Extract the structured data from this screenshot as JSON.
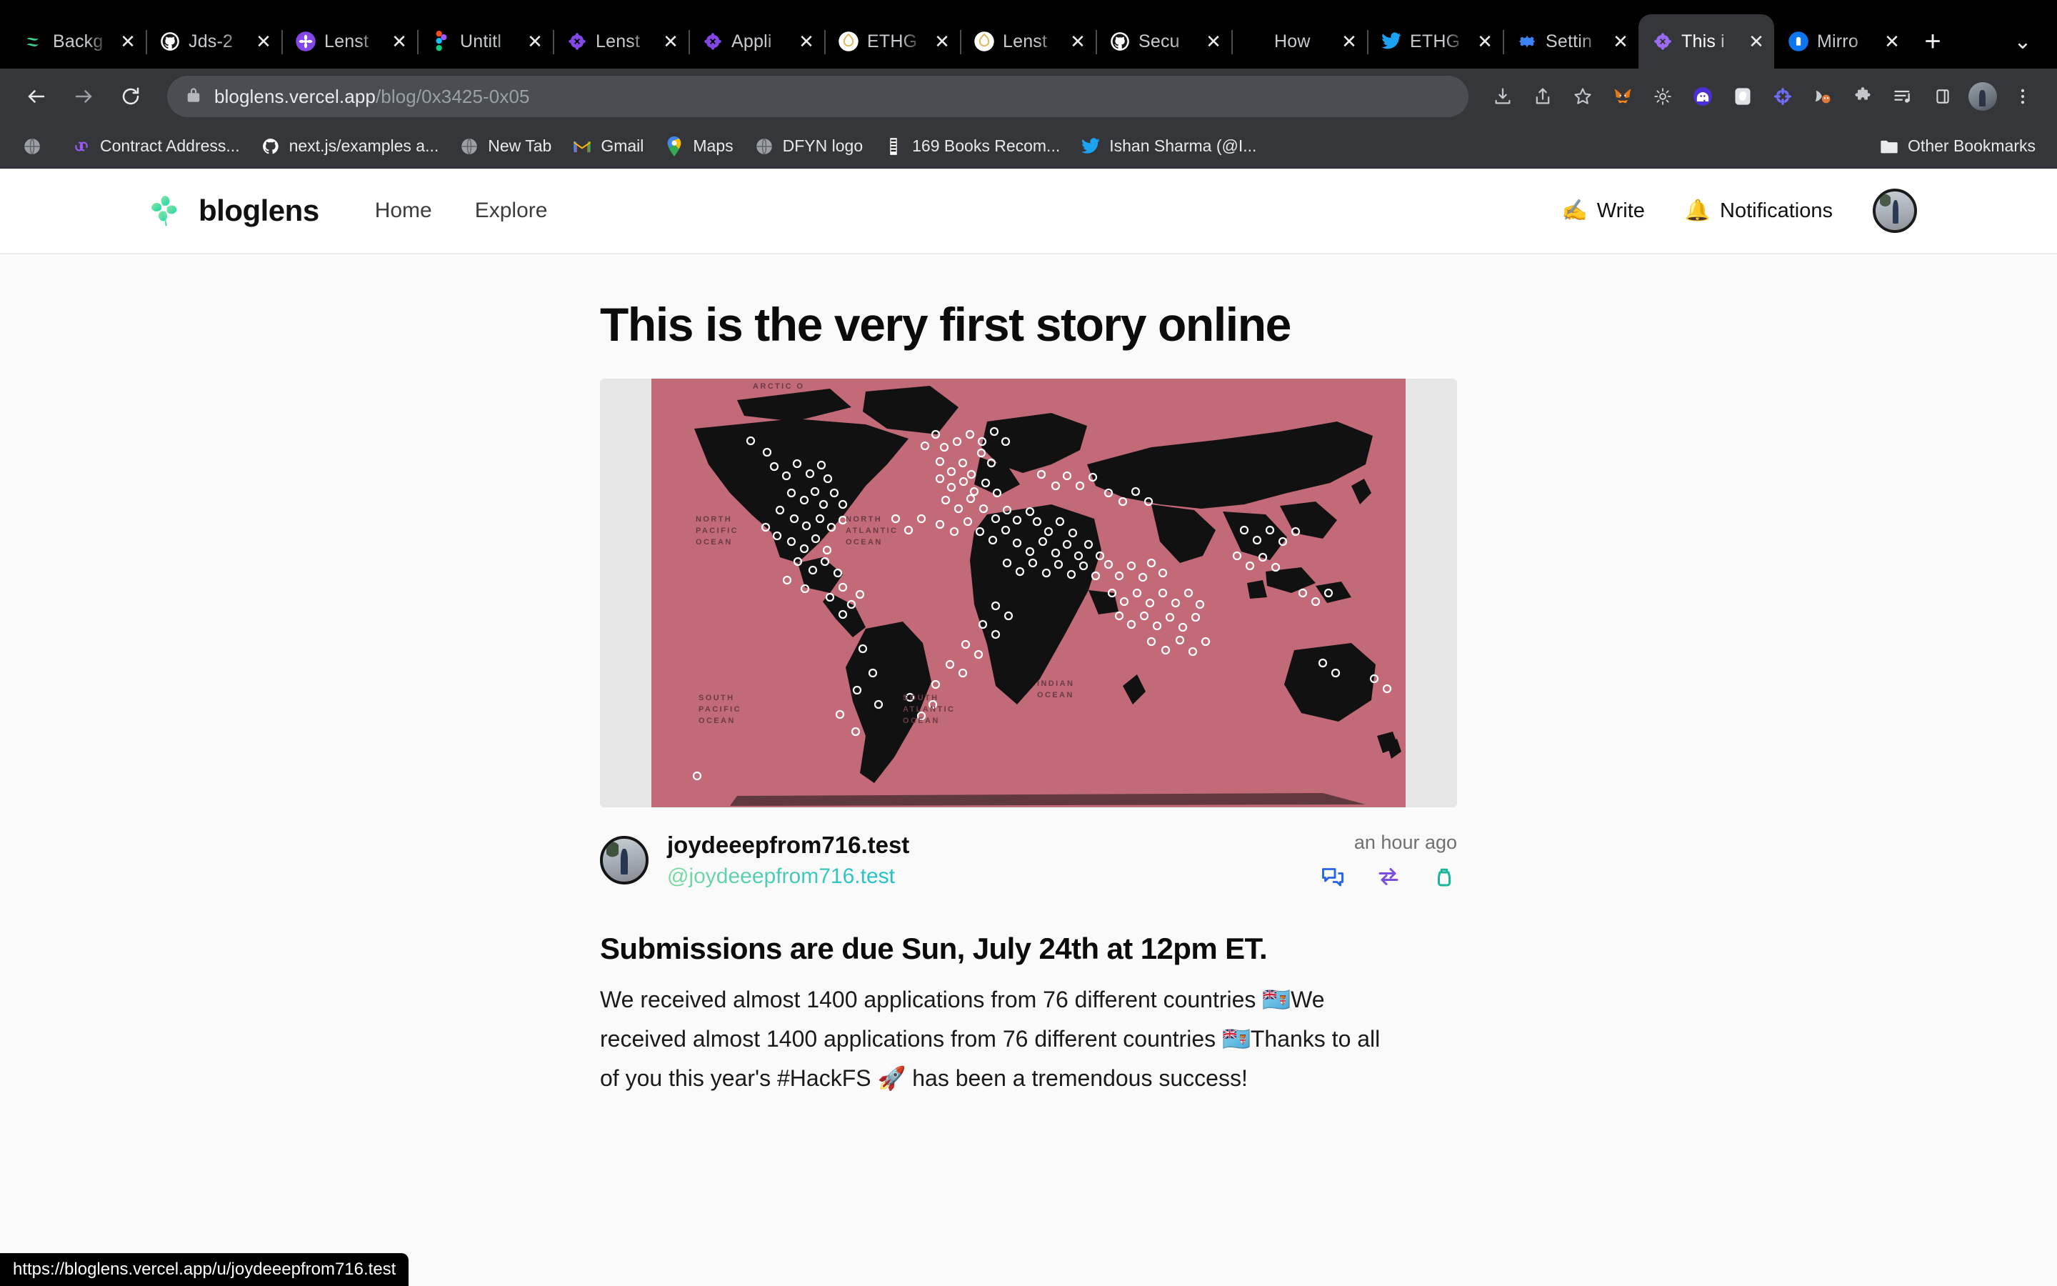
{
  "browser": {
    "tabs": [
      {
        "title": "Backg",
        "icon": "supabase-icon",
        "active": false
      },
      {
        "title": "Jds-2",
        "icon": "github-icon",
        "active": false
      },
      {
        "title": "Lenst",
        "icon": "lens-circle-icon",
        "active": false
      },
      {
        "title": "Untitl",
        "icon": "figma-icon",
        "active": false
      },
      {
        "title": "Lenst",
        "icon": "lens-flower-icon",
        "active": false
      },
      {
        "title": "Appli",
        "icon": "lens-flower-icon",
        "active": false
      },
      {
        "title": "ETHG",
        "icon": "ethglobal-icon",
        "active": false
      },
      {
        "title": "Lenst",
        "icon": "ethglobal-icon",
        "active": false
      },
      {
        "title": "Secu",
        "icon": "github-icon",
        "active": false
      },
      {
        "title": "How",
        "icon": "blank-icon",
        "active": false
      },
      {
        "title": "ETHG",
        "icon": "twitter-icon",
        "active": false
      },
      {
        "title": "Settin",
        "icon": "gear-icon",
        "active": false
      },
      {
        "title": "This i",
        "icon": "lens-flower-icon",
        "active": true
      },
      {
        "title": "Mirro",
        "icon": "mirror-icon",
        "active": false
      }
    ],
    "new_tab_label": "+",
    "tab_list_caret": "⌄",
    "nav": {
      "back": "←",
      "forward": "→",
      "reload": "⟳"
    },
    "omnibox": {
      "lock_icon": "lock-icon",
      "domain": "bloglens.vercel.app",
      "path": "/blog/0x3425-0x05"
    },
    "toolbar_right_icons": [
      "download-icon",
      "share-icon",
      "bookmark-star-icon",
      "metamask-icon",
      "brightness-icon",
      "phantom-icon",
      "rabby-icon",
      "flower-extension-icon",
      "fox-extension-icon",
      "puzzle-extension-icon",
      "reading-list-icon",
      "sidepanel-icon",
      "profile-avatar-icon",
      "kebab-menu-icon"
    ],
    "bookmarks": [
      {
        "label": "",
        "icon": "globe-icon"
      },
      {
        "label": "Contract Address...",
        "icon": "chain-link-icon"
      },
      {
        "label": "next.js/examples a...",
        "icon": "github-icon"
      },
      {
        "label": "New Tab",
        "icon": "globe-icon"
      },
      {
        "label": "Gmail",
        "icon": "gmail-icon"
      },
      {
        "label": "Maps",
        "icon": "maps-pin-icon"
      },
      {
        "label": "DFYN logo",
        "icon": "globe-icon"
      },
      {
        "label": "169 Books Recom...",
        "icon": "notion-icon"
      },
      {
        "label": "Ishan Sharma (@I...",
        "icon": "twitter-icon"
      }
    ],
    "other_bookmarks": {
      "label": "Other Bookmarks",
      "icon": "folder-icon"
    },
    "status_bar_url": "https://bloglens.vercel.app/u/joydeeepfrom716.test"
  },
  "site": {
    "brand": {
      "name": "bloglens",
      "icon": "clover-logo-icon"
    },
    "nav": [
      {
        "label": "Home"
      },
      {
        "label": "Explore"
      }
    ],
    "actions": {
      "write": {
        "label": "Write",
        "icon": "writing-hand-icon"
      },
      "notifications": {
        "label": "Notifications",
        "icon": "bell-icon"
      },
      "avatar": "user-avatar"
    }
  },
  "article": {
    "title": "This is the very first story online",
    "hero_image": {
      "alt": "world-map-with-location-dots",
      "background_color": "#c26a77",
      "land_color": "#111111",
      "ocean_labels": [
        "ARCTIC O",
        "NORTH PACIFIC OCEAN",
        "NORTH ATLANTIC OCEAN",
        "SOUTH PACIFIC OCEAN",
        "SOUTH ATLANTIC OCEAN",
        "INDIAN OCEAN"
      ]
    },
    "author": {
      "name": "joydeeepfrom716.test",
      "handle": "@joydeeepfrom716.test"
    },
    "timestamp": "an hour ago",
    "actions": [
      {
        "name": "comment-icon",
        "color": "#2563eb"
      },
      {
        "name": "mirror-icon",
        "color": "#7c4dde"
      },
      {
        "name": "collect-icon",
        "color": "#18b79a"
      }
    ],
    "heading": "Submissions are due Sun, July 24th at 12pm ET.",
    "paragraph": "We received almost 1400 applications from 76 different countries 🇫🇯We received almost 1400 applications from 76 different countries 🇫🇯Thanks to all of you this year's #HackFS 🚀 has been a tremendous success!"
  }
}
